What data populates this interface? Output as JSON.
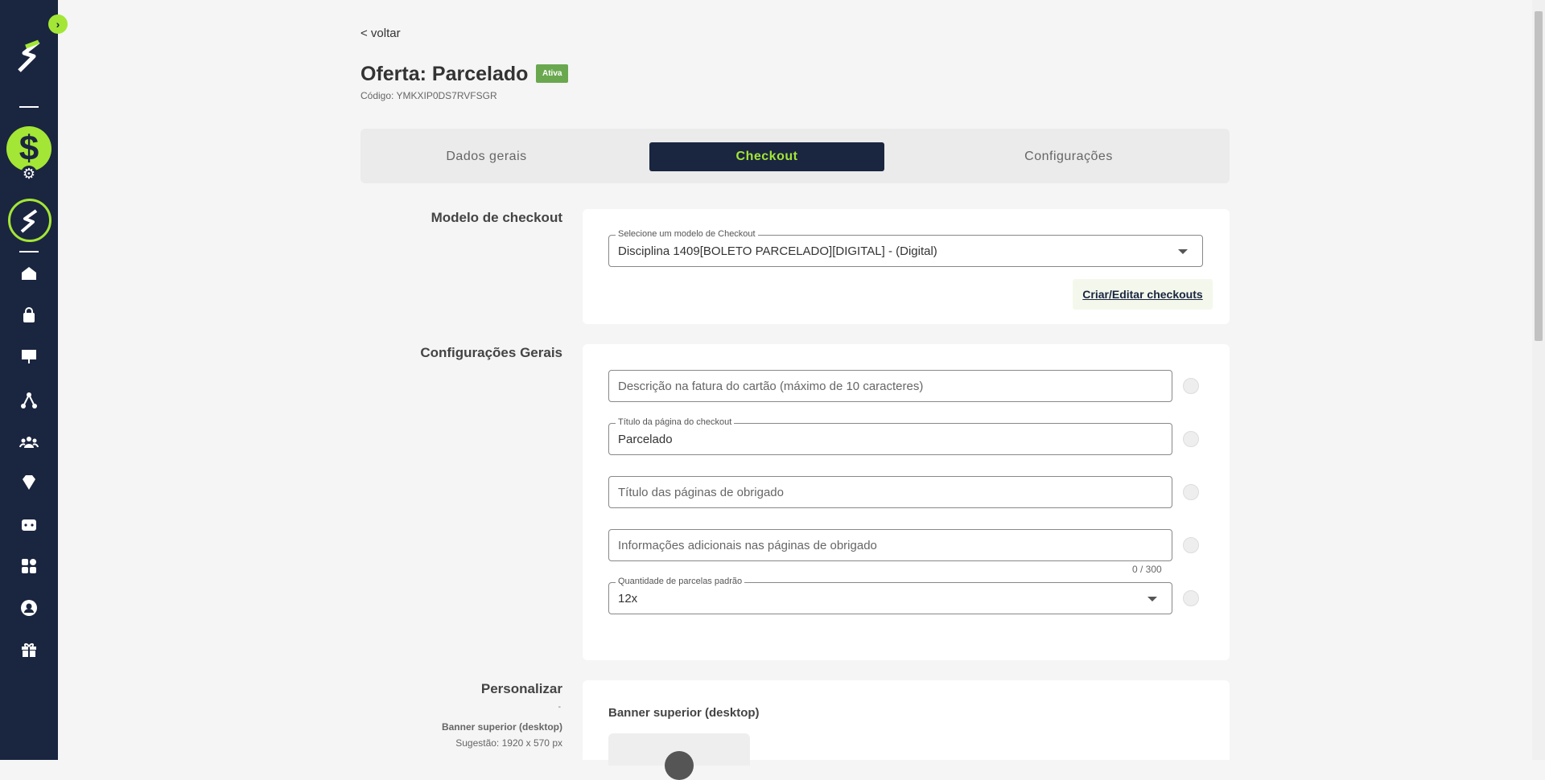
{
  "sidebar": {
    "expand_label": "›",
    "money_symbol": "$",
    "gear_symbol": "⚙",
    "icons": [
      "home-icon",
      "shopping-bag-icon",
      "presentation-icon",
      "affiliates-icon",
      "users-icon",
      "diamond-icon",
      "dice-icon",
      "apps-icon",
      "account-icon",
      "gift-icon"
    ]
  },
  "header": {
    "back": "< voltar",
    "title": "Oferta: Parcelado",
    "status_badge": "Ativa",
    "code": "Código: YMKXIP0DS7RVFSGR"
  },
  "tabs": [
    {
      "label": "Dados gerais",
      "active": false
    },
    {
      "label": "Checkout",
      "active": true
    },
    {
      "label": "Configurações",
      "active": false
    }
  ],
  "checkout_model": {
    "section_label": "Modelo de checkout",
    "select_label": "Selecione um modelo de Checkout",
    "select_value": "Disciplina 1409[BOLETO PARCELADO][DIGITAL] - (Digital)",
    "edit_link": "Criar/Editar checkouts"
  },
  "general": {
    "section_label": "Configurações Gerais",
    "card_description_placeholder": "Descrição na fatura do cartão (máximo de 10 caracteres)",
    "page_title_label": "Título da página do checkout",
    "page_title_value": "Parcelado",
    "thanks_title_placeholder": "Título das páginas de obrigado",
    "thanks_info_placeholder": "Informações adicionais nas páginas de obrigado",
    "char_counter": "0 / 300",
    "installments_label": "Quantidade de parcelas padrão",
    "installments_value": "12x"
  },
  "customize": {
    "section_label": "Personalizar",
    "dot": "-",
    "banner_label": "Banner superior (desktop)",
    "banner_hint": "Sugestão: 1920 x 570 px",
    "banner_title": "Banner superior (desktop)"
  },
  "colors": {
    "sidebar_bg": "#1a2540",
    "accent": "#a3e635",
    "badge": "#6aa84f"
  }
}
